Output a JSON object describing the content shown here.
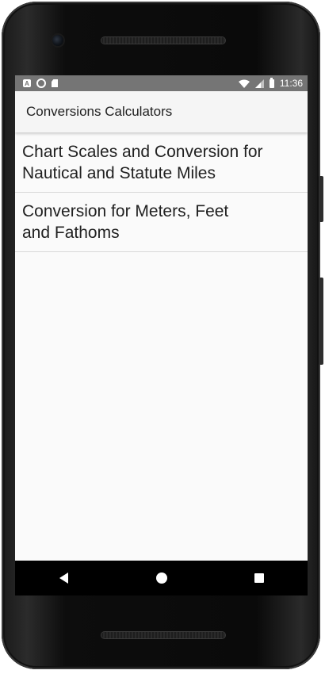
{
  "statusbar": {
    "time": "11:36",
    "left_icons": [
      "app-a-icon",
      "circle-icon",
      "sd-card-icon"
    ],
    "right_icons": [
      "wifi-icon",
      "cell-signal-icon",
      "battery-icon"
    ]
  },
  "appbar": {
    "title": "Conversions Calculators"
  },
  "list": {
    "items": [
      {
        "label": "Chart Scales and Conversion for\nNautical and Statute Miles"
      },
      {
        "label": "Conversion for Meters, Feet\nand Fathoms"
      }
    ]
  },
  "navbar": {
    "buttons": [
      "back-icon",
      "home-icon",
      "recents-icon"
    ]
  },
  "colors": {
    "statusbar": "#757575",
    "appbar": "#f5f5f5",
    "background": "#fafafa",
    "divider": "#d8d8d8",
    "text": "#212121",
    "navbar": "#000000"
  }
}
